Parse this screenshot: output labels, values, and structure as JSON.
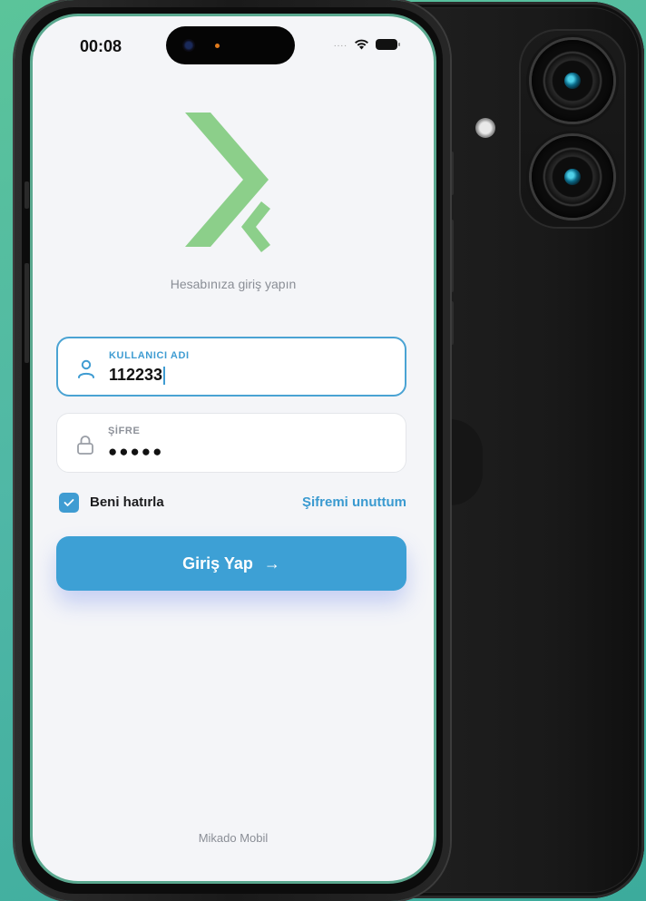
{
  "status_bar": {
    "time": "00:08",
    "signal": "....",
    "wifi_icon": "wifi-icon",
    "battery_icon": "battery-icon"
  },
  "login": {
    "subtitle": "Hesabınıza giriş yapın",
    "username_label": "KULLANICI ADI",
    "username_value": "112233",
    "password_label": "ŞİFRE",
    "password_value": "●●●●●",
    "remember_label": "Beni hatırla",
    "remember_checked": true,
    "forgot_link": "Şifremi unuttum",
    "submit_label": "Giriş Yap",
    "submit_arrow": "→"
  },
  "footer": {
    "brand": "Mikado Mobil"
  },
  "colors": {
    "accent": "#3da0d5",
    "logo": "#8ccf8a",
    "background": "#5bc49a"
  }
}
